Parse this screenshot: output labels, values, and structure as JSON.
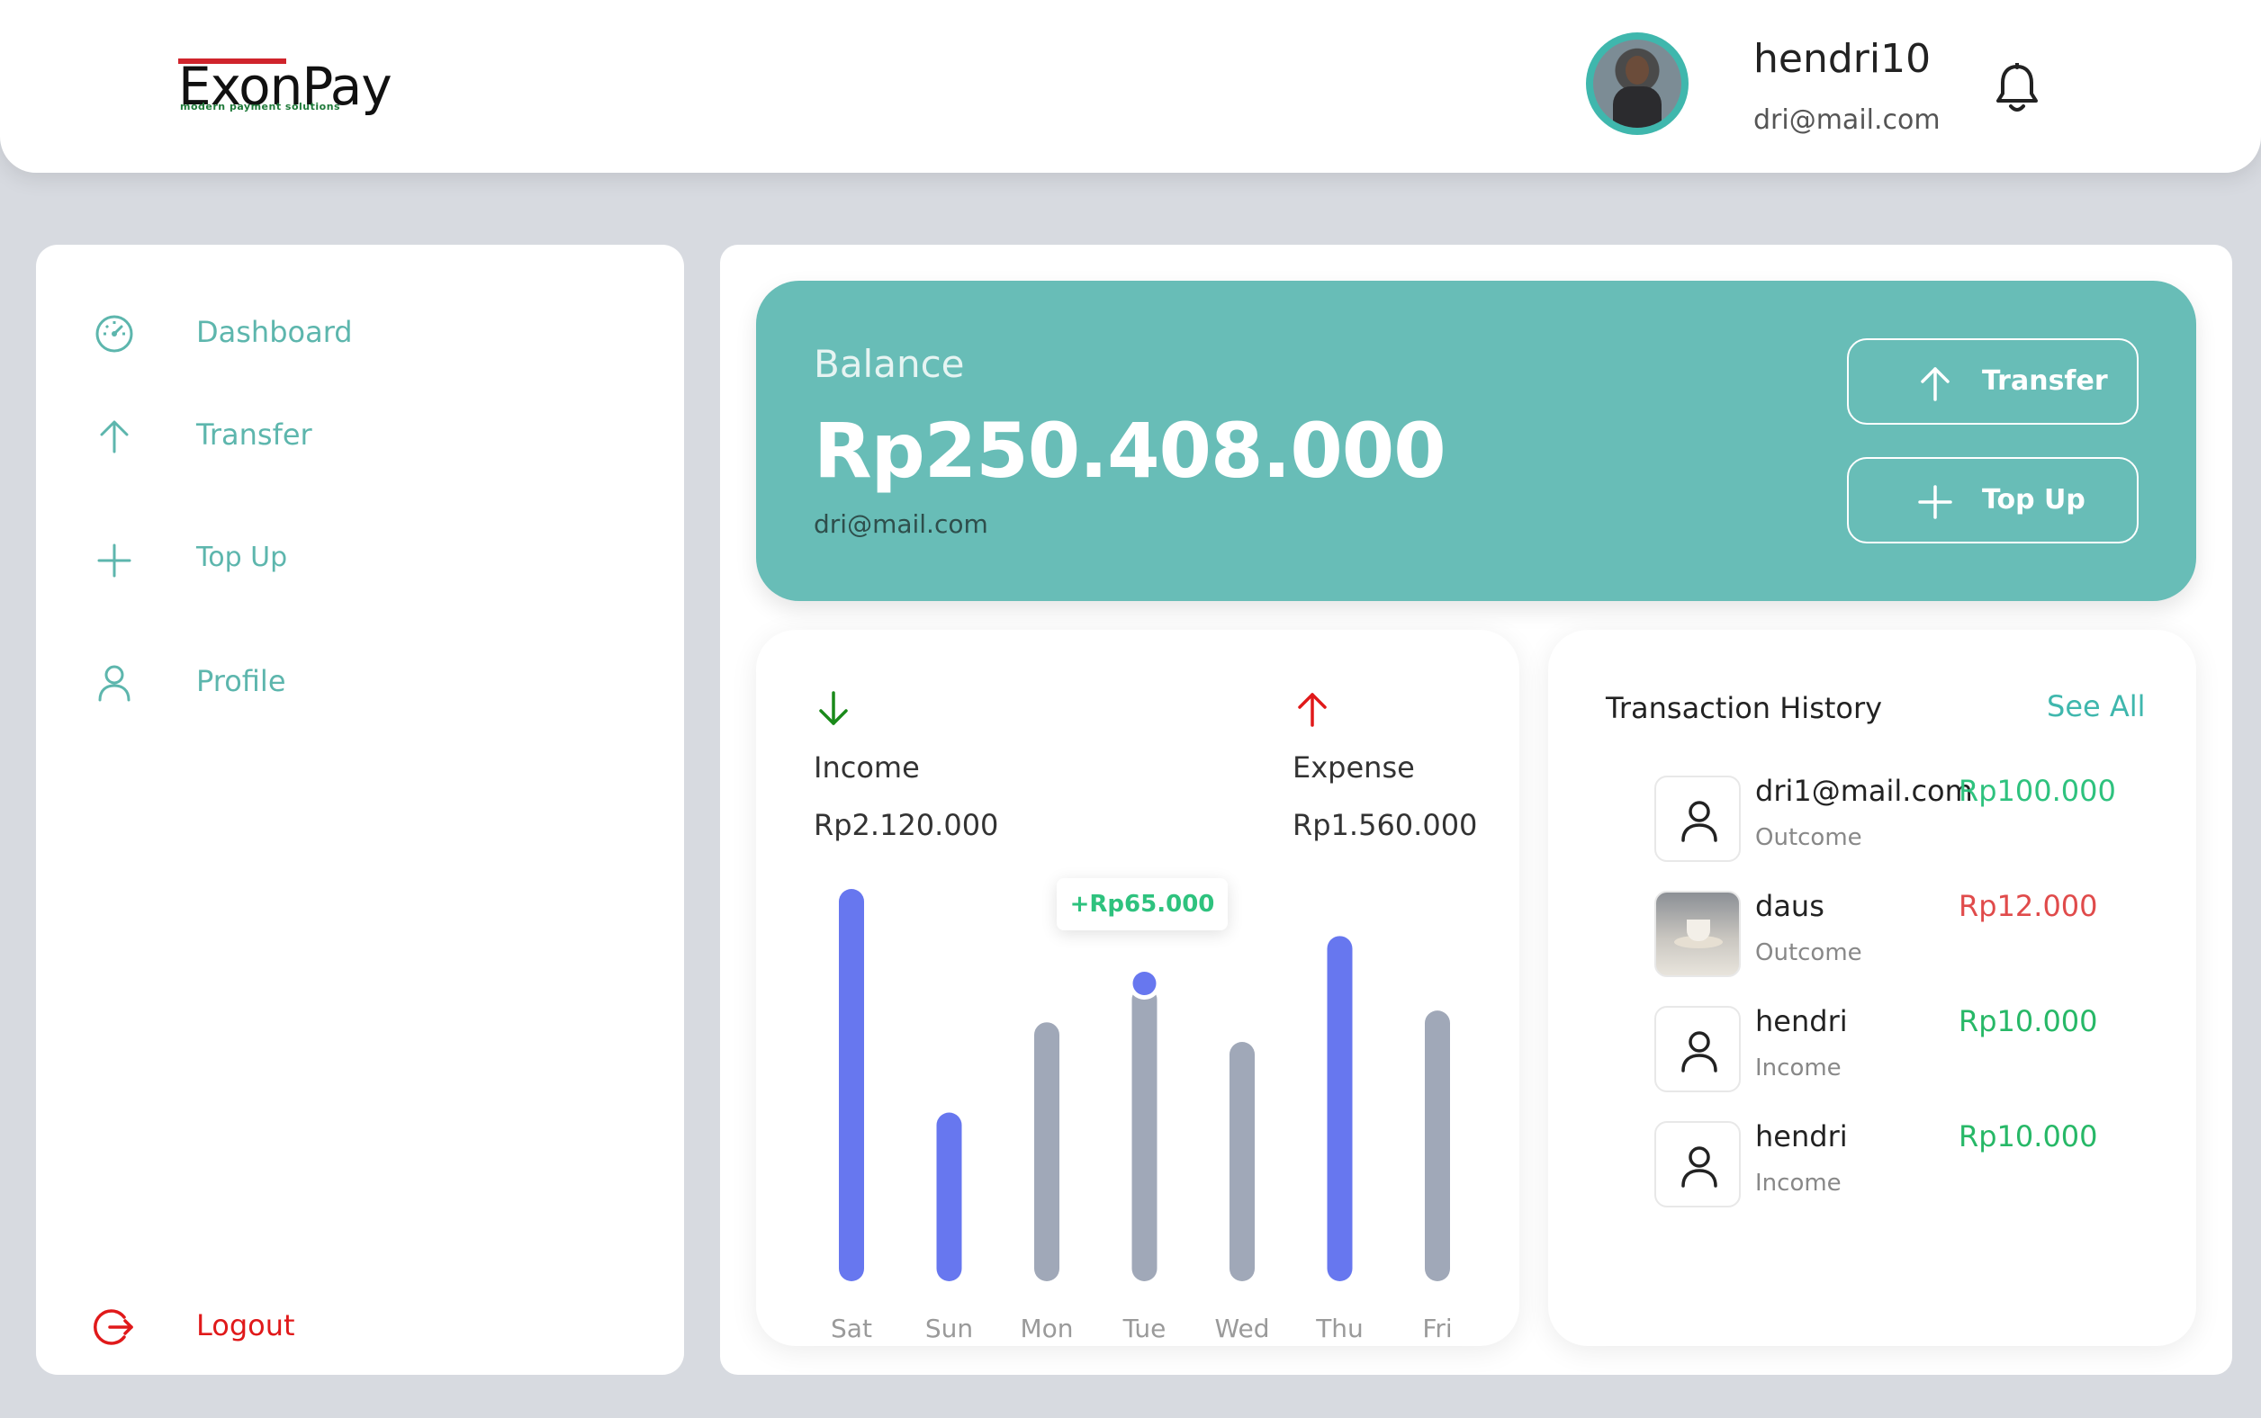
{
  "brand": {
    "name": "ExonPay",
    "tagline": "modern payment solutions"
  },
  "user": {
    "name": "hendri10",
    "email": "dri@mail.com"
  },
  "sidebar": {
    "items": [
      {
        "label": "Dashboard",
        "icon": "dashboard-icon"
      },
      {
        "label": "Transfer",
        "icon": "arrow-up-icon"
      },
      {
        "label": "Top Up",
        "icon": "plus-icon"
      },
      {
        "label": "Profile",
        "icon": "user-icon"
      }
    ],
    "logout": {
      "label": "Logout",
      "icon": "logout-icon"
    }
  },
  "balance": {
    "label": "Balance",
    "amount": "Rp250.408.000",
    "email": "dri@mail.com",
    "transfer_label": "Transfer",
    "topup_label": "Top Up"
  },
  "summary": {
    "income_label": "Income",
    "income_value": "Rp2.120.000",
    "expense_label": "Expense",
    "expense_value": "Rp1.560.000",
    "tooltip": "+Rp65.000"
  },
  "chart_data": {
    "type": "bar",
    "categories": [
      "Sat",
      "Sun",
      "Mon",
      "Tue",
      "Wed",
      "Thu",
      "Fri"
    ],
    "values": [
      100,
      43,
      66,
      75,
      61,
      88,
      69
    ],
    "highlighted": [
      true,
      true,
      false,
      false,
      false,
      true,
      false
    ],
    "active_index": 3,
    "ylim": [
      0,
      100
    ],
    "colors": {
      "highlight": "#6777ef",
      "normal": "#a0a8b8"
    }
  },
  "transactions": {
    "title": "Transaction History",
    "see_all": "See All",
    "items": [
      {
        "name": "dri1@mail.com",
        "type": "Outcome",
        "amount": "Rp100.000",
        "amount_color": "#2ec27e",
        "avatar": "user-icon"
      },
      {
        "name": "daus",
        "type": "Outcome",
        "amount": "Rp12.000",
        "amount_color": "#e04b4b",
        "avatar": "photo"
      },
      {
        "name": "hendri",
        "type": "Income",
        "amount": "Rp10.000",
        "amount_color": "#27b867",
        "avatar": "user-icon"
      },
      {
        "name": "hendri",
        "type": "Income",
        "amount": "Rp10.000",
        "amount_color": "#27b867",
        "avatar": "user-icon"
      }
    ]
  },
  "colors": {
    "accent": "#68bdb7",
    "teal_text": "#5db6ad",
    "danger": "#e0191a",
    "income_arrow": "#1a8a1a",
    "expense_arrow": "#e0191a"
  }
}
